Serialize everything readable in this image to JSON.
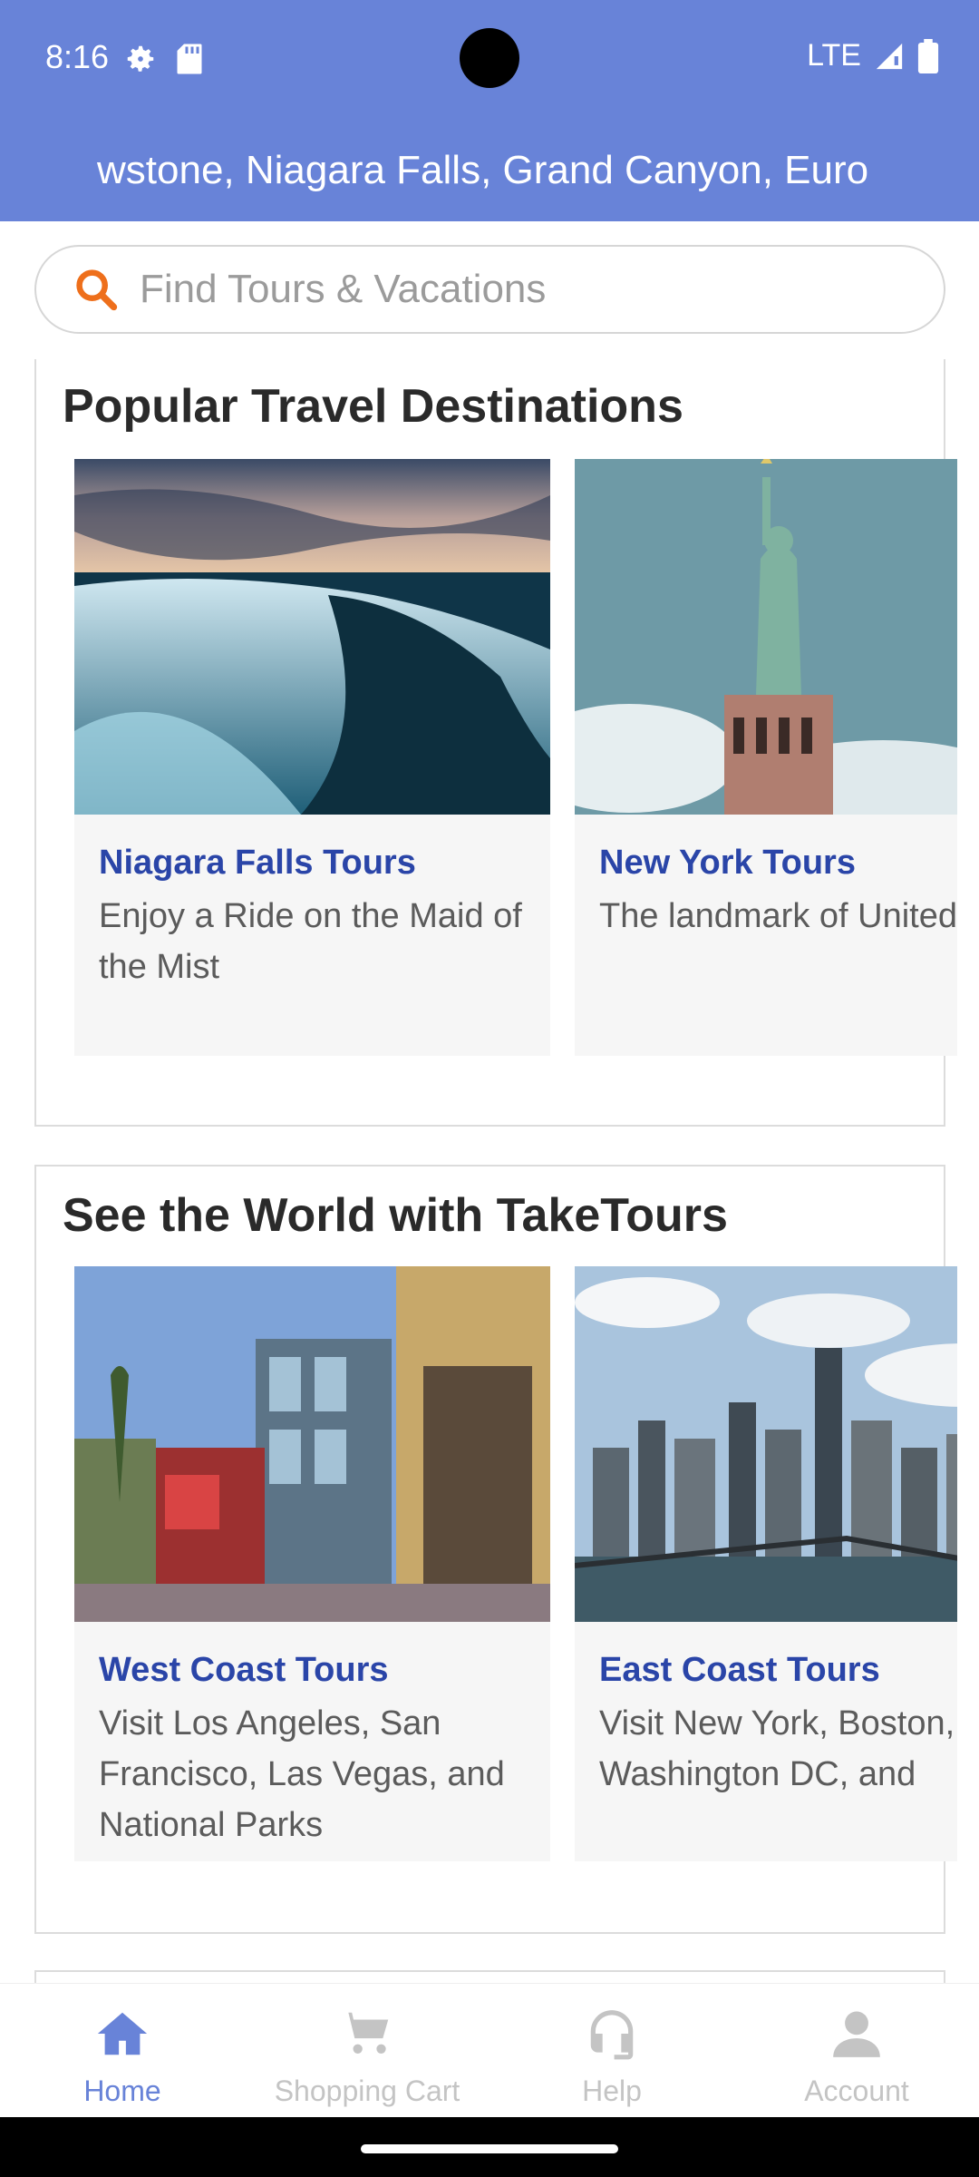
{
  "status": {
    "time": "8:16",
    "network": "LTE"
  },
  "header": {
    "marquee_text": "wstone, Niagara Falls, Grand Canyon, Euro"
  },
  "search": {
    "placeholder": "Find Tours & Vacations",
    "icon": "search-icon"
  },
  "sections": [
    {
      "title": "Popular Travel Destinations",
      "cards": [
        {
          "title": "Niagara Falls Tours",
          "description": "Enjoy a Ride on the Maid of the Mist"
        },
        {
          "title": "New York Tours",
          "description": "The landmark of United State"
        }
      ]
    },
    {
      "title": "See the World with TakeTours",
      "cards": [
        {
          "title": "West Coast Tours",
          "description": "Visit Los Angeles, San Francisco, Las Vegas, and National Parks"
        },
        {
          "title": "East Coast Tours",
          "description": "Visit New York, Boston, Washington DC, and"
        }
      ]
    }
  ],
  "bottom_nav": [
    {
      "label": "Home",
      "icon": "home-icon",
      "active": true
    },
    {
      "label": "Shopping Cart",
      "icon": "cart-icon",
      "active": false
    },
    {
      "label": "Help",
      "icon": "headset-icon",
      "active": false
    },
    {
      "label": "Account",
      "icon": "account-icon",
      "active": false
    }
  ],
  "colors": {
    "header": "#6883d8",
    "card_title": "#2a45a8",
    "search_icon": "#ee6f1b"
  }
}
